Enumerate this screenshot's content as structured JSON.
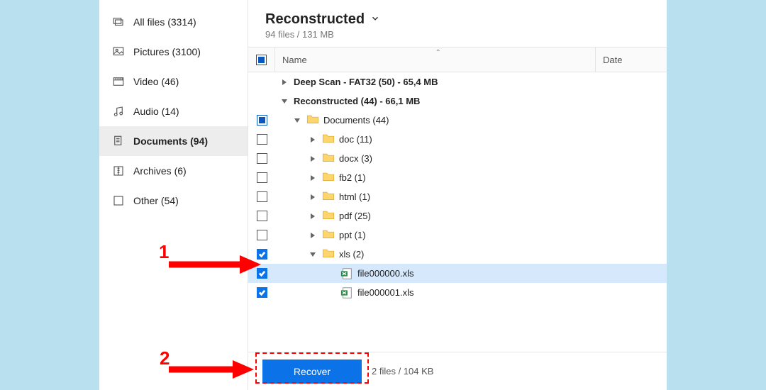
{
  "sidebar": {
    "items": [
      {
        "label": "All files (3314)"
      },
      {
        "label": "Pictures (3100)"
      },
      {
        "label": "Video (46)"
      },
      {
        "label": "Audio (14)"
      },
      {
        "label": "Documents (94)"
      },
      {
        "label": "Archives (6)"
      },
      {
        "label": "Other (54)"
      }
    ]
  },
  "header": {
    "title": "Reconstructed",
    "subtitle": "94 files / 131 MB"
  },
  "columns": {
    "name": "Name",
    "date": "Date"
  },
  "tree": {
    "deepscan": "Deep Scan - FAT32 (50) - 65,4 MB",
    "reconstructed": "Reconstructed (44) - 66,1 MB",
    "documents": "Documents (44)",
    "folders": [
      {
        "label": "doc (11)"
      },
      {
        "label": "docx (3)"
      },
      {
        "label": "fb2 (1)"
      },
      {
        "label": "html (1)"
      },
      {
        "label": "pdf (25)"
      },
      {
        "label": "ppt (1)"
      }
    ],
    "xls": "xls (2)",
    "files": [
      {
        "label": "file000000.xls"
      },
      {
        "label": "file000001.xls"
      }
    ]
  },
  "footer": {
    "recover": "Recover",
    "status": "2 files / 104 KB"
  },
  "annotations": {
    "n1": "1",
    "n2": "2"
  }
}
